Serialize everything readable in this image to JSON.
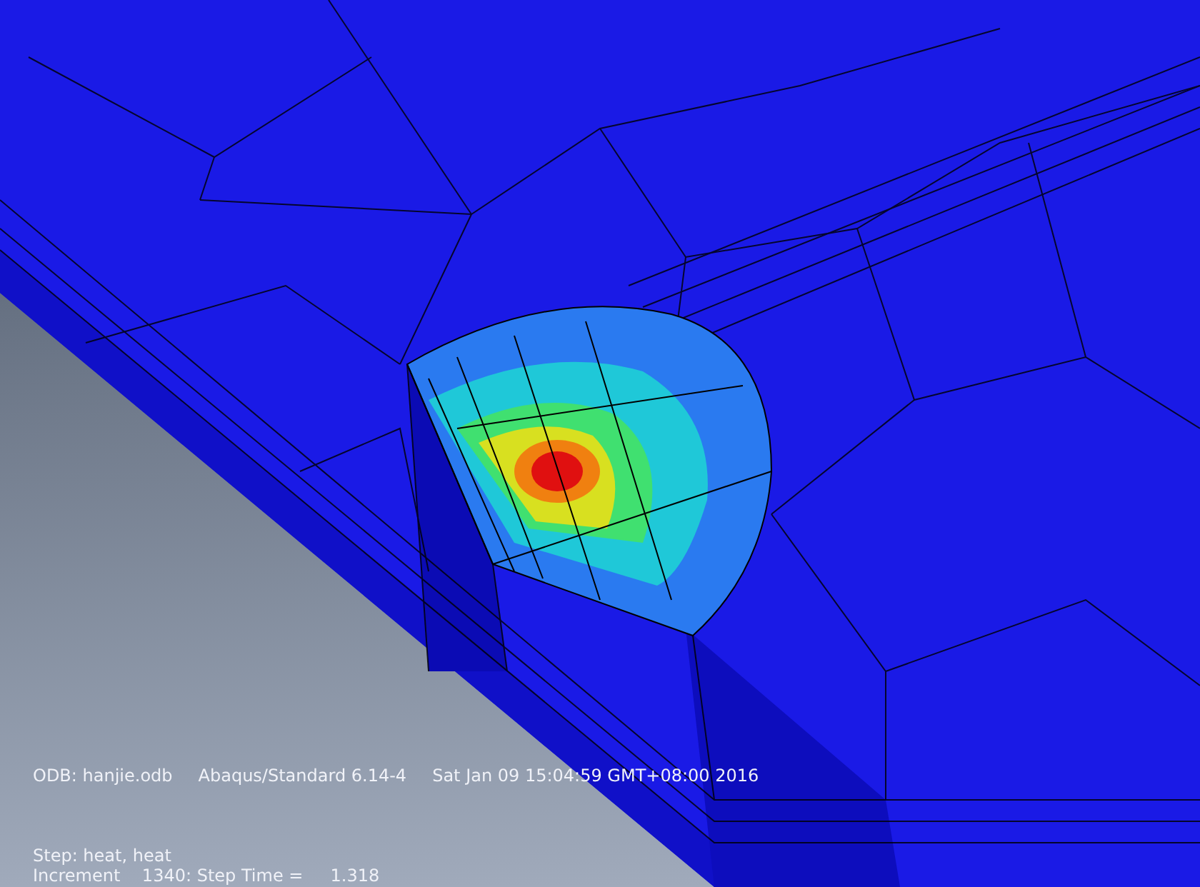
{
  "viewport_info": {
    "odb": "ODB: hanjie.odb",
    "solver": "Abaqus/Standard 6.14-4",
    "date": "Sat Jan 09 15:04:59 GMT+08:00 2016",
    "step": "Step: heat, heat",
    "increment": "Increment    1340: Step Time =     1.318"
  }
}
